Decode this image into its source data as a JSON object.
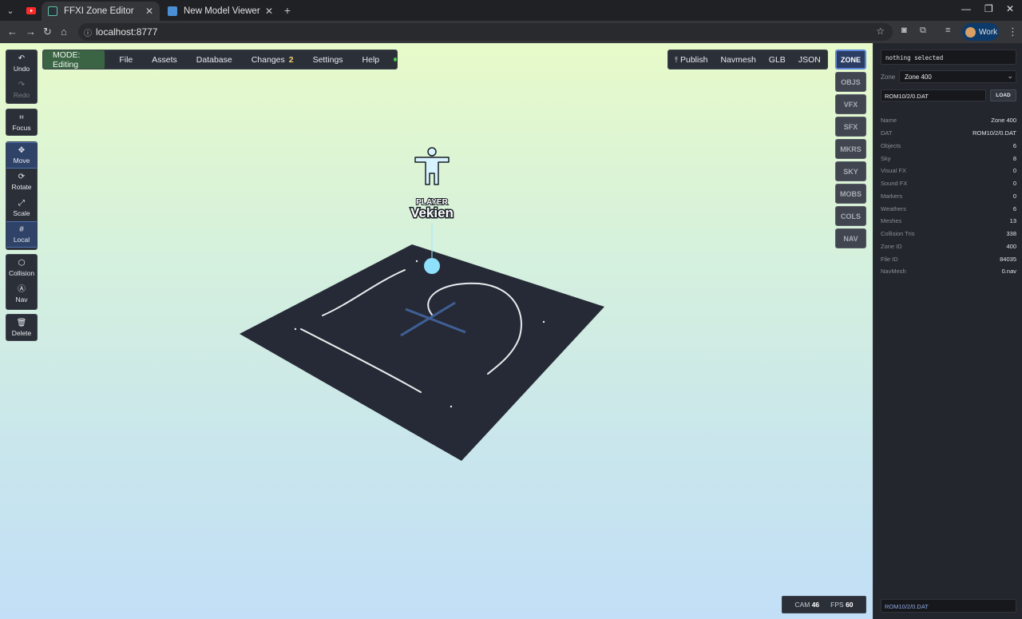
{
  "browser": {
    "tabs": [
      {
        "title": "FFXI Zone Editor",
        "active": true
      },
      {
        "title": "New Model Viewer: DATura - FF",
        "active": false
      }
    ],
    "new_tab_symbol": "+",
    "url": "localhost:8777",
    "profile_label": "Work"
  },
  "menu": {
    "mode_label": "MODE: Editing",
    "file": "File",
    "assets": "Assets",
    "database": "Database",
    "changes": "Changes",
    "changes_count": "2",
    "settings": "Settings",
    "help": "Help"
  },
  "toolbar_right": {
    "publish": "Publish",
    "navmesh": "Navmesh",
    "glb": "GLB",
    "json": "JSON"
  },
  "tools": {
    "undo": "Undo",
    "redo": "Redo",
    "focus": "Focus",
    "move": "Move",
    "rotate": "Rotate",
    "scale": "Scale",
    "local": "Local",
    "collision": "Collision",
    "nav": "Nav",
    "delete": "Delete"
  },
  "side_tabs": [
    "ZONE",
    "OBJS",
    "VFX",
    "SFX",
    "MKRS",
    "SKY",
    "MOBS",
    "COLS",
    "NAV"
  ],
  "player": {
    "label": "PLAYER",
    "name": "Vekien"
  },
  "status": {
    "cam_label": "CAM",
    "cam": "46",
    "fps_label": "FPS",
    "fps": "60"
  },
  "panel": {
    "selection": "nothing selected",
    "zone_label": "Zone",
    "zone_value": "Zone 400",
    "path": "ROM10/2/0.DAT",
    "load_button": "LOAD",
    "properties": [
      {
        "k": "Name",
        "v": "Zone 400"
      },
      {
        "k": "DAT",
        "v": "ROM10/2/0.DAT"
      },
      {
        "k": "Objects",
        "v": "6"
      },
      {
        "k": "Sky",
        "v": "8"
      },
      {
        "k": "Visual FX",
        "v": "0"
      },
      {
        "k": "Sound FX",
        "v": "0"
      },
      {
        "k": "Markers",
        "v": "0"
      },
      {
        "k": "Weathers",
        "v": "6"
      },
      {
        "k": "Meshes",
        "v": "13"
      },
      {
        "k": "Collision Tris",
        "v": "338"
      },
      {
        "k": "Zone ID",
        "v": "400"
      },
      {
        "k": "File ID",
        "v": "84035"
      },
      {
        "k": "NavMesh",
        "v": "0.nav"
      }
    ],
    "footer_path": "ROM10/2/0.DAT"
  },
  "colors": {
    "accent": "#5a86d9",
    "mode_bg": "#3a6444",
    "changes_badge": "#f1d36b",
    "status_dot": "#4ccc4c",
    "floor": "#262a36",
    "player_marker": "#8fe0fb"
  }
}
